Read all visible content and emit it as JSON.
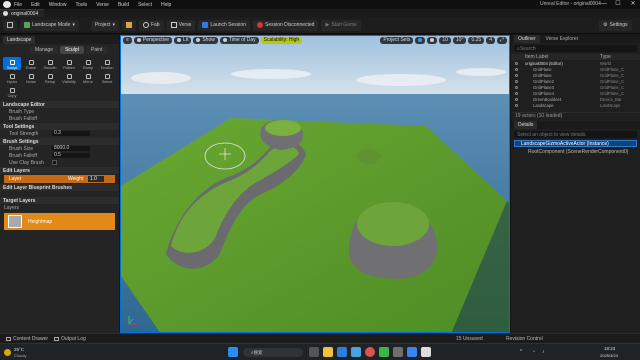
{
  "menu": {
    "items": [
      "File",
      "Edit",
      "Window",
      "Tools",
      "Verse",
      "Build",
      "Select",
      "Help"
    ],
    "window_title": "Unreal Editor - original0004",
    "minimize": "—",
    "maximize": "☐",
    "close": "✕"
  },
  "doc_tab": {
    "label": "original0004"
  },
  "toolbar": {
    "mode": "Landscape Mode",
    "project": "Project",
    "fab": "Fab",
    "verse": "Verse",
    "launch": "Launch Session",
    "session": "Session Disconnected",
    "start": "Start Game",
    "settings": "Settings"
  },
  "left_panel": {
    "title": "Landscape",
    "modes": [
      "Manage",
      "Sculpt",
      "Paint"
    ],
    "active_mode": "Sculpt",
    "tools": [
      "Sculpt",
      "Erase",
      "Smooth",
      "Flatten",
      "Ramp",
      "Erosion",
      "Hydro",
      "Noise",
      "Retop",
      "Visibility",
      "Mirror",
      "Select",
      "Copy"
    ],
    "sections": {
      "editor": "Landscape Editor",
      "tool_settings": "Tool Settings",
      "brush_settings": "Brush Settings",
      "edit_layers": "Edit Layers",
      "edit_layer_bp": "Edit Layer Blueprint Brushes",
      "target_layers": "Target Layers",
      "layers": "Layers"
    },
    "rows": {
      "brush_type": "Brush Type",
      "brush_falloff": "Brush Falloff",
      "tool_strength": "Tool Strength",
      "tool_strength_val": "0.3",
      "brush_size": "Brush Size",
      "brush_size_val": "8000.0",
      "brush_falloff2": "Brush Falloff",
      "brush_falloff_val": "0.5",
      "use_clay": "Use Clay Brush"
    },
    "edit_layer": {
      "name": "Layer",
      "weight_label": "Weight",
      "weight": "1.0"
    },
    "target_layer": {
      "name": "Heightmap"
    }
  },
  "viewport": {
    "buttons": [
      "Perspective",
      "Lit",
      "Show",
      "Time of Day",
      "Scalability: High"
    ],
    "right_buttons": [
      "Project Sets",
      "10",
      "10°",
      "0.25",
      "4"
    ],
    "scalability_color": "#b8c80f",
    "sky_top": "#a9c4dd",
    "sea": "#3a6f9a",
    "grass": "#5d9a2c"
  },
  "outliner": {
    "tabs": [
      "Outliner",
      "Verse Explorer"
    ],
    "search_placeholder": "Search",
    "col_label": "Item Label",
    "col_type": "Type",
    "items": [
      {
        "label": "original0004 (Editor)",
        "type": "World"
      },
      {
        "label": "GridPlane",
        "type": "GridPlane_C"
      },
      {
        "label": "GridPlane",
        "type": "GridPlane_C"
      },
      {
        "label": "GridPlane2",
        "type": "GridPlane_C"
      },
      {
        "label": "GridPlane3",
        "type": "GridPlane_C"
      },
      {
        "label": "GridPlane4",
        "type": "GridPlane_C"
      },
      {
        "label": "GreenBoulder4",
        "type": "Device_Bar"
      },
      {
        "label": "Landscape",
        "type": "Landscape"
      }
    ],
    "count": "19 actors (10 loaded)"
  },
  "details": {
    "tab": "Details",
    "search": "Select an object to view details.",
    "component": "LandscapeGizmoActiveActor (Instance)",
    "root": "RootComponent (SceneRenderComponent0)"
  },
  "status": {
    "content": "Content Drawer",
    "output": "Output Log",
    "unsaved": "15 Unsaved",
    "revision": "Revision Control"
  },
  "taskbar": {
    "weather_temp": "25°C",
    "weather_desc": "Cloudy",
    "search": "搜索",
    "time": "18:23",
    "date": "2025/3/24"
  }
}
